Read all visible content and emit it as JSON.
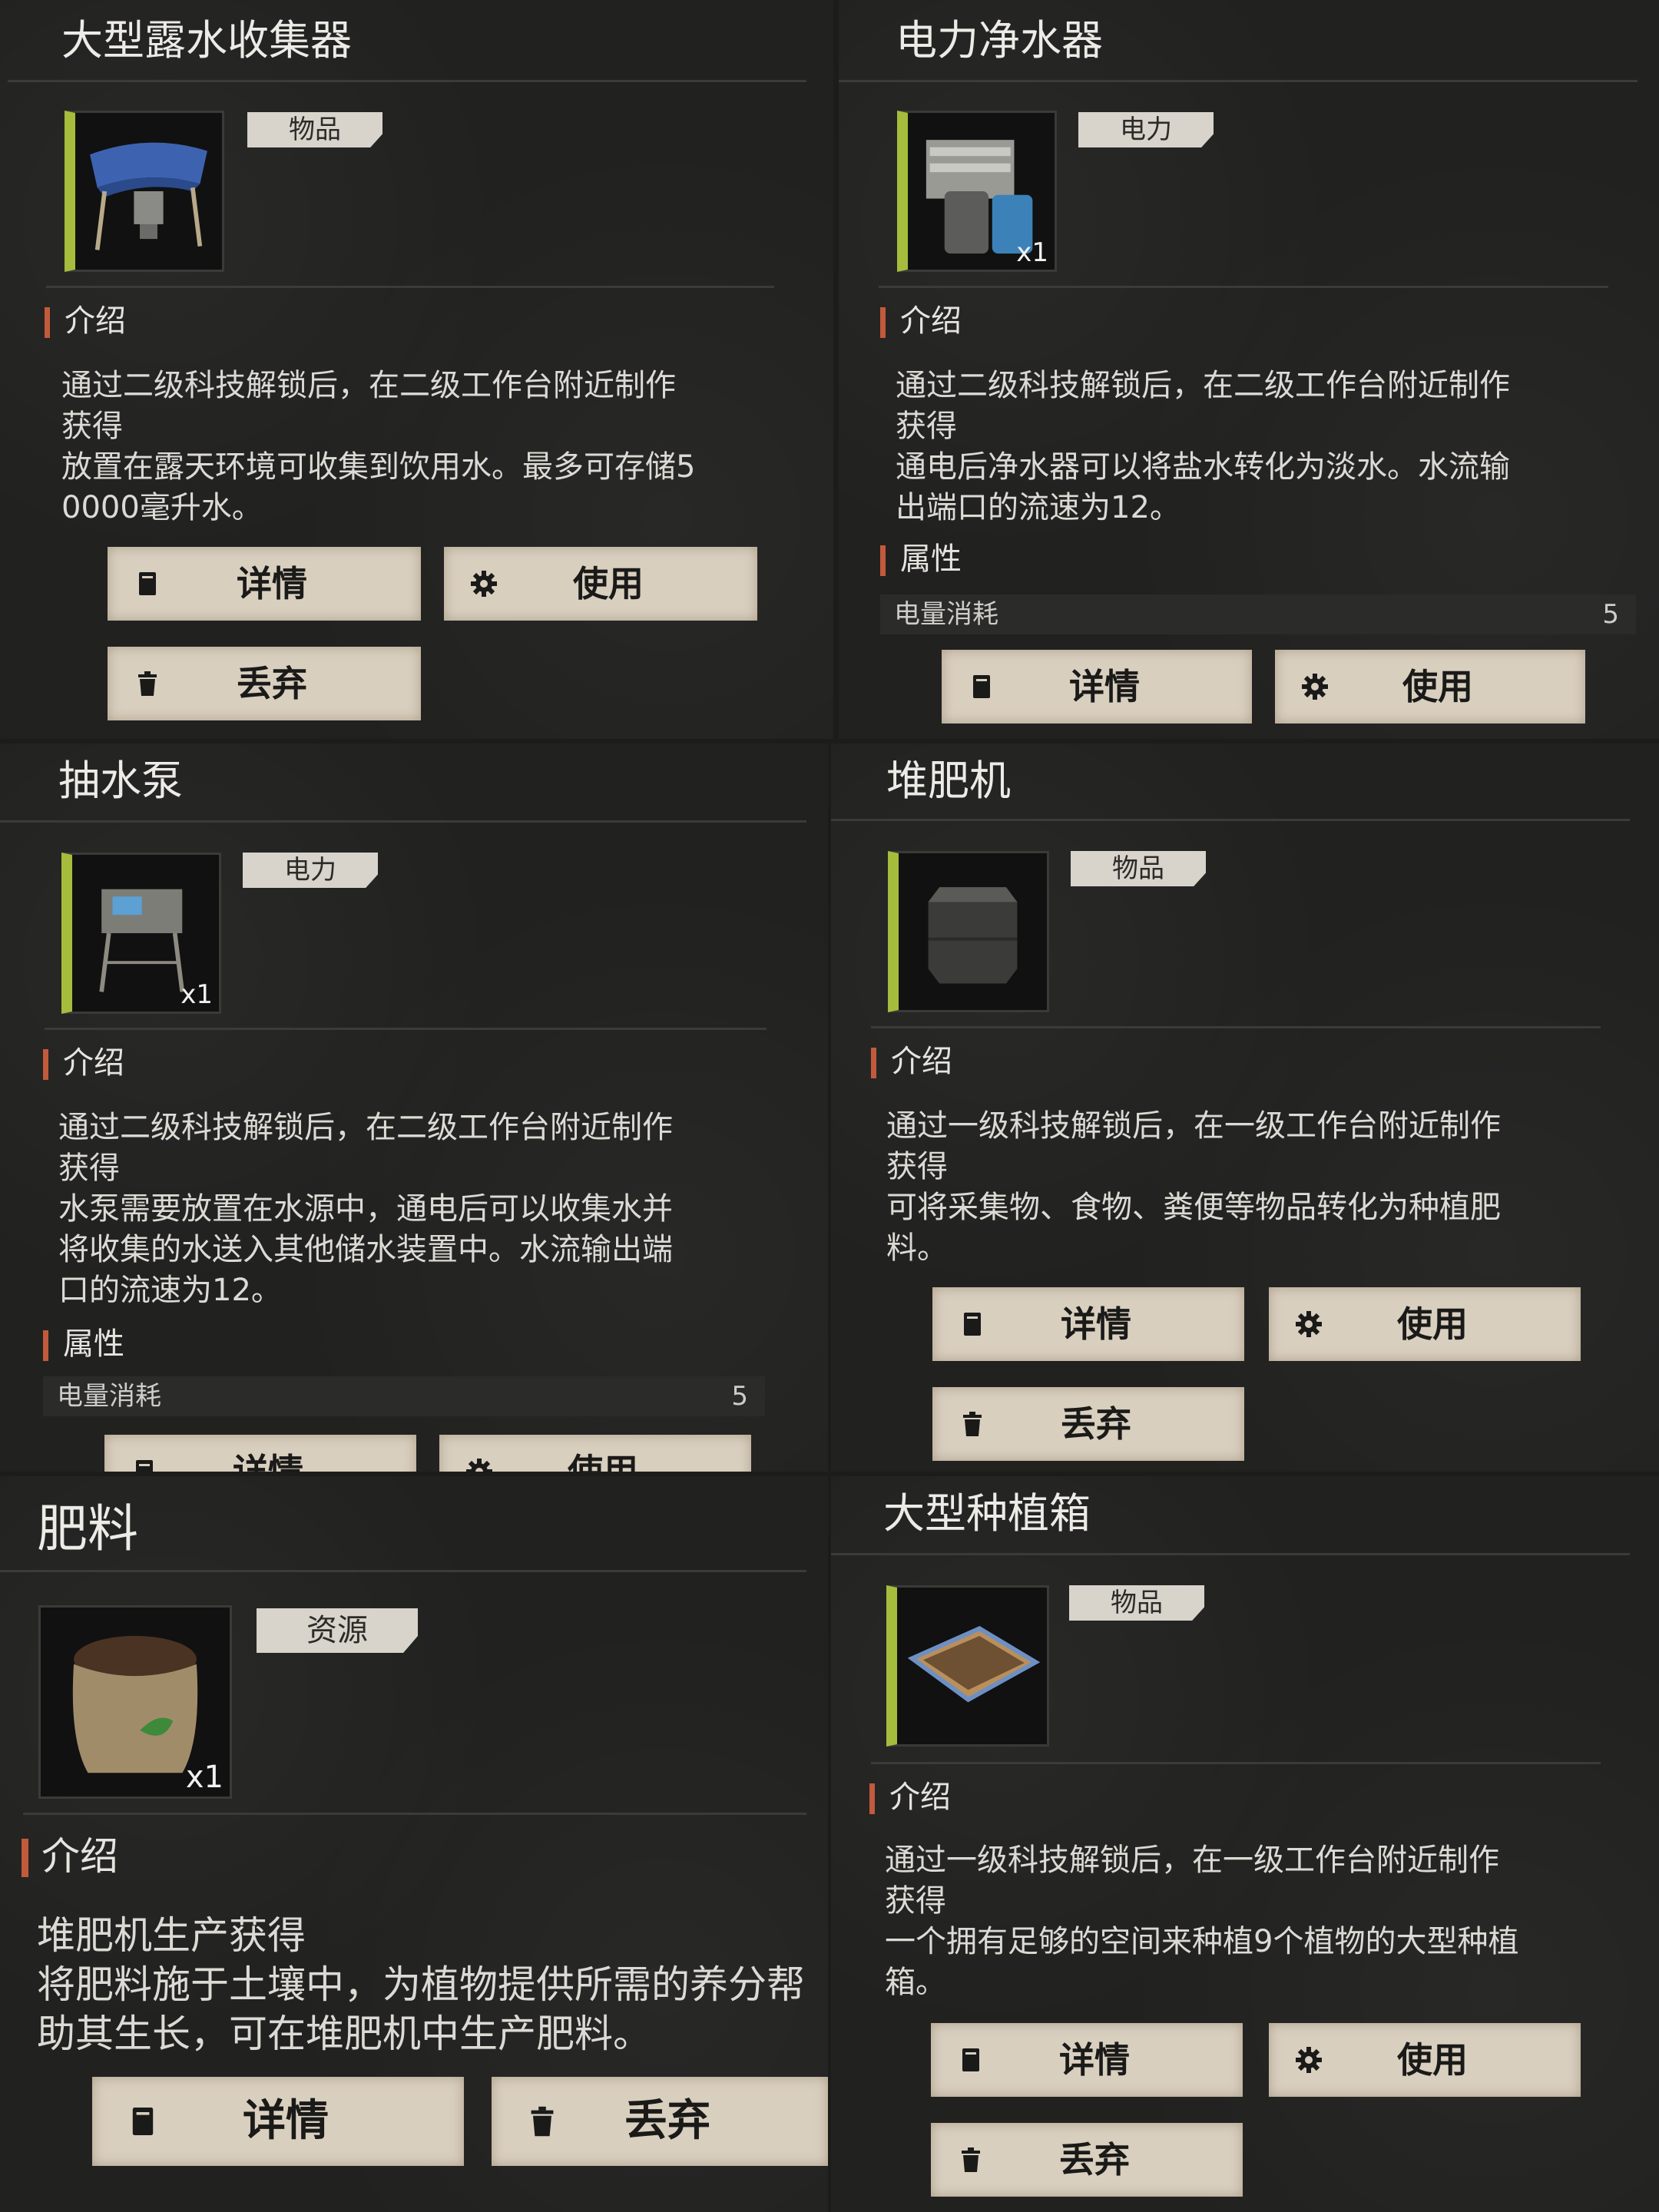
{
  "labels": {
    "intro": "介绍",
    "attributes": "属性",
    "details": "详情",
    "use": "使用",
    "discard": "丢弃"
  },
  "icons": {
    "details": "book-icon",
    "use": "gear-icon",
    "discard": "trash-icon"
  },
  "colors": {
    "accent_bar": "#a6bc3c",
    "section_marker": "#c25a3c",
    "button_bg": "#d9cfbf",
    "tag_bg": "#d8d3cb",
    "panel_bg": "#212120"
  },
  "cards": [
    {
      "title": "大型露水收集器",
      "tag": "物品",
      "desc": [
        "通过二级科技解锁后，在二级工作台附近制作",
        "获得",
        "放置在露天环境可收集到饮用水。最多可存储5",
        "0000毫升水。"
      ]
    },
    {
      "title": "电力净水器",
      "tag": "电力",
      "quantity": "x1",
      "desc": [
        "通过二级科技解锁后，在二级工作台附近制作",
        "获得",
        "通电后净水器可以将盐水转化为淡水。水流输",
        "出端口的流速为12。"
      ],
      "property": {
        "name": "电量消耗",
        "value": "5"
      }
    },
    {
      "title": "抽水泵",
      "tag": "电力",
      "quantity": "x1",
      "desc": [
        "通过二级科技解锁后，在二级工作台附近制作",
        "获得",
        "水泵需要放置在水源中，通电后可以收集水并",
        "将收集的水送入其他储水装置中。水流输出端",
        "口的流速为12。"
      ],
      "property": {
        "name": "电量消耗",
        "value": "5"
      }
    },
    {
      "title": "堆肥机",
      "tag": "物品",
      "desc": [
        "通过一级科技解锁后，在一级工作台附近制作",
        "获得",
        "可将采集物、食物、粪便等物品转化为种植肥",
        "料。"
      ]
    },
    {
      "title": "肥料",
      "tag": "资源",
      "quantity": "x1",
      "desc": [
        "堆肥机生产获得",
        "将肥料施于土壤中，为植物提供所需的养分帮",
        "助其生长，可在堆肥机中生产肥料。"
      ]
    },
    {
      "title": "大型种植箱",
      "tag": "物品",
      "desc": [
        "通过一级科技解锁后，在一级工作台附近制作",
        "获得",
        "一个拥有足够的空间来种植9个植物的大型种植",
        "箱。"
      ]
    }
  ]
}
